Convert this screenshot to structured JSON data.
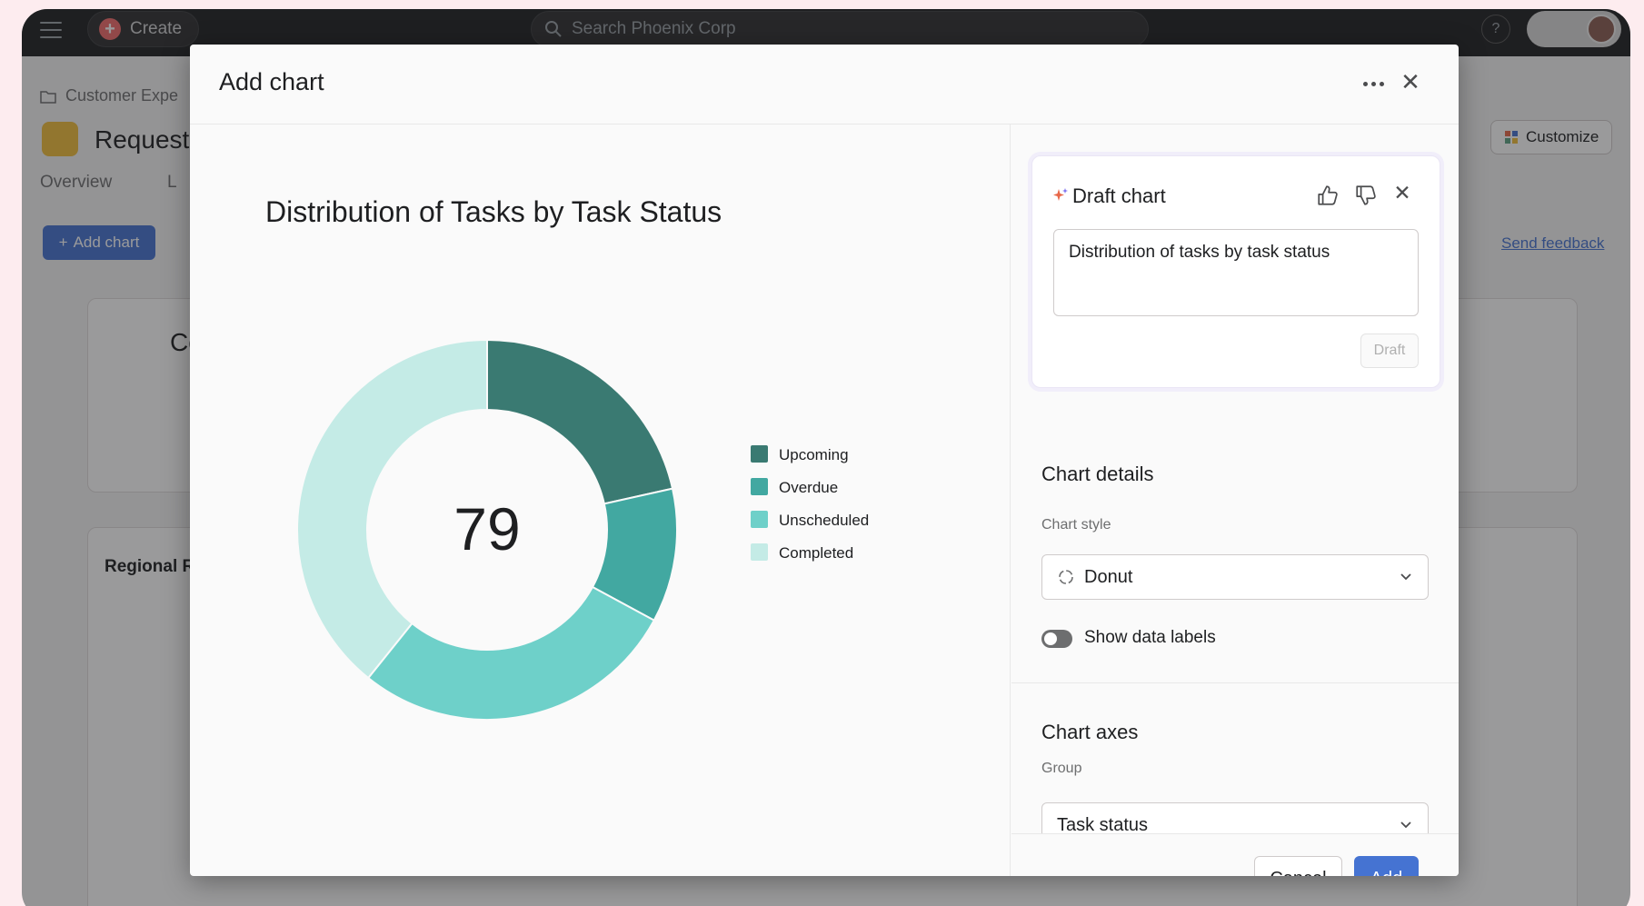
{
  "background_app": {
    "create_label": "Create",
    "search_placeholder": "Search Phoenix Corp",
    "help_label": "?",
    "breadcrumb": "Customer Expe",
    "project_title": "Request",
    "tab_overview": "Overview",
    "tab_list": "L",
    "customize_label": "Customize",
    "add_chart_label": "Add chart",
    "send_feedback_label": "Send feedback",
    "card_title_top": "Co",
    "card_title_regional": "Regional R"
  },
  "modal": {
    "title": "Add chart",
    "chart": {
      "title": "Distribution of Tasks by Task Status",
      "center_value": "79"
    },
    "draft": {
      "title": "Draft chart",
      "prompt_text": "Distribution of tasks by task status",
      "draft_button": "Draft"
    },
    "details": {
      "section_title": "Chart details",
      "style_label": "Chart style",
      "style_value": "Donut",
      "show_labels": "Show data labels",
      "show_labels_enabled": false
    },
    "axes": {
      "section_title": "Chart axes",
      "group_label": "Group",
      "group_value": "Task status"
    },
    "footer": {
      "cancel": "Cancel",
      "add": "Add"
    }
  },
  "chart_data": {
    "type": "pie",
    "title": "Distribution of Tasks by Task Status",
    "total": 79,
    "categories": [
      "Upcoming",
      "Overdue",
      "Unscheduled",
      "Completed"
    ],
    "values": [
      17,
      9,
      22,
      31
    ],
    "colors": [
      "#3a7a72",
      "#42a8a1",
      "#6ed0c9",
      "#c4ebe6"
    ],
    "legend_position": "right"
  }
}
